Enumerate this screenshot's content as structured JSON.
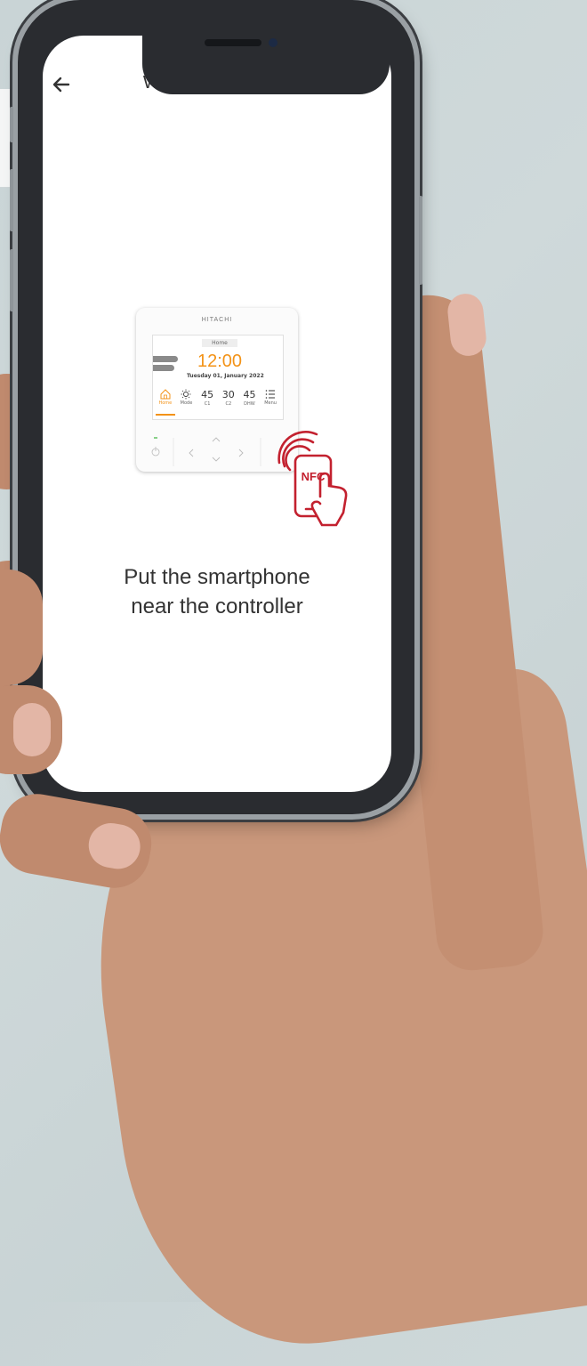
{
  "header": {
    "title": "Write through NFC",
    "back_icon": "arrow-left-icon"
  },
  "controller": {
    "brand": "HITACHI",
    "tab_label": "Home",
    "time": "12:00",
    "date": "Tuesday 01, January 2022",
    "items": [
      {
        "icon": "home-icon",
        "value": "",
        "label": "Home"
      },
      {
        "icon": "sun-icon",
        "value": "",
        "label": "Mode"
      },
      {
        "icon": "",
        "value": "45",
        "label": "C1"
      },
      {
        "icon": "",
        "value": "30",
        "label": "C2"
      },
      {
        "icon": "",
        "value": "45",
        "label": "DHW"
      },
      {
        "icon": "menu-icon",
        "value": "",
        "label": "Menu"
      }
    ]
  },
  "nfc": {
    "label": "NFC",
    "accent_color": "#c3212f"
  },
  "instruction": {
    "line1": "Put the smartphone",
    "line2": "near the controller"
  },
  "colors": {
    "accent_orange": "#f39318",
    "nfc_red": "#c3212f"
  }
}
